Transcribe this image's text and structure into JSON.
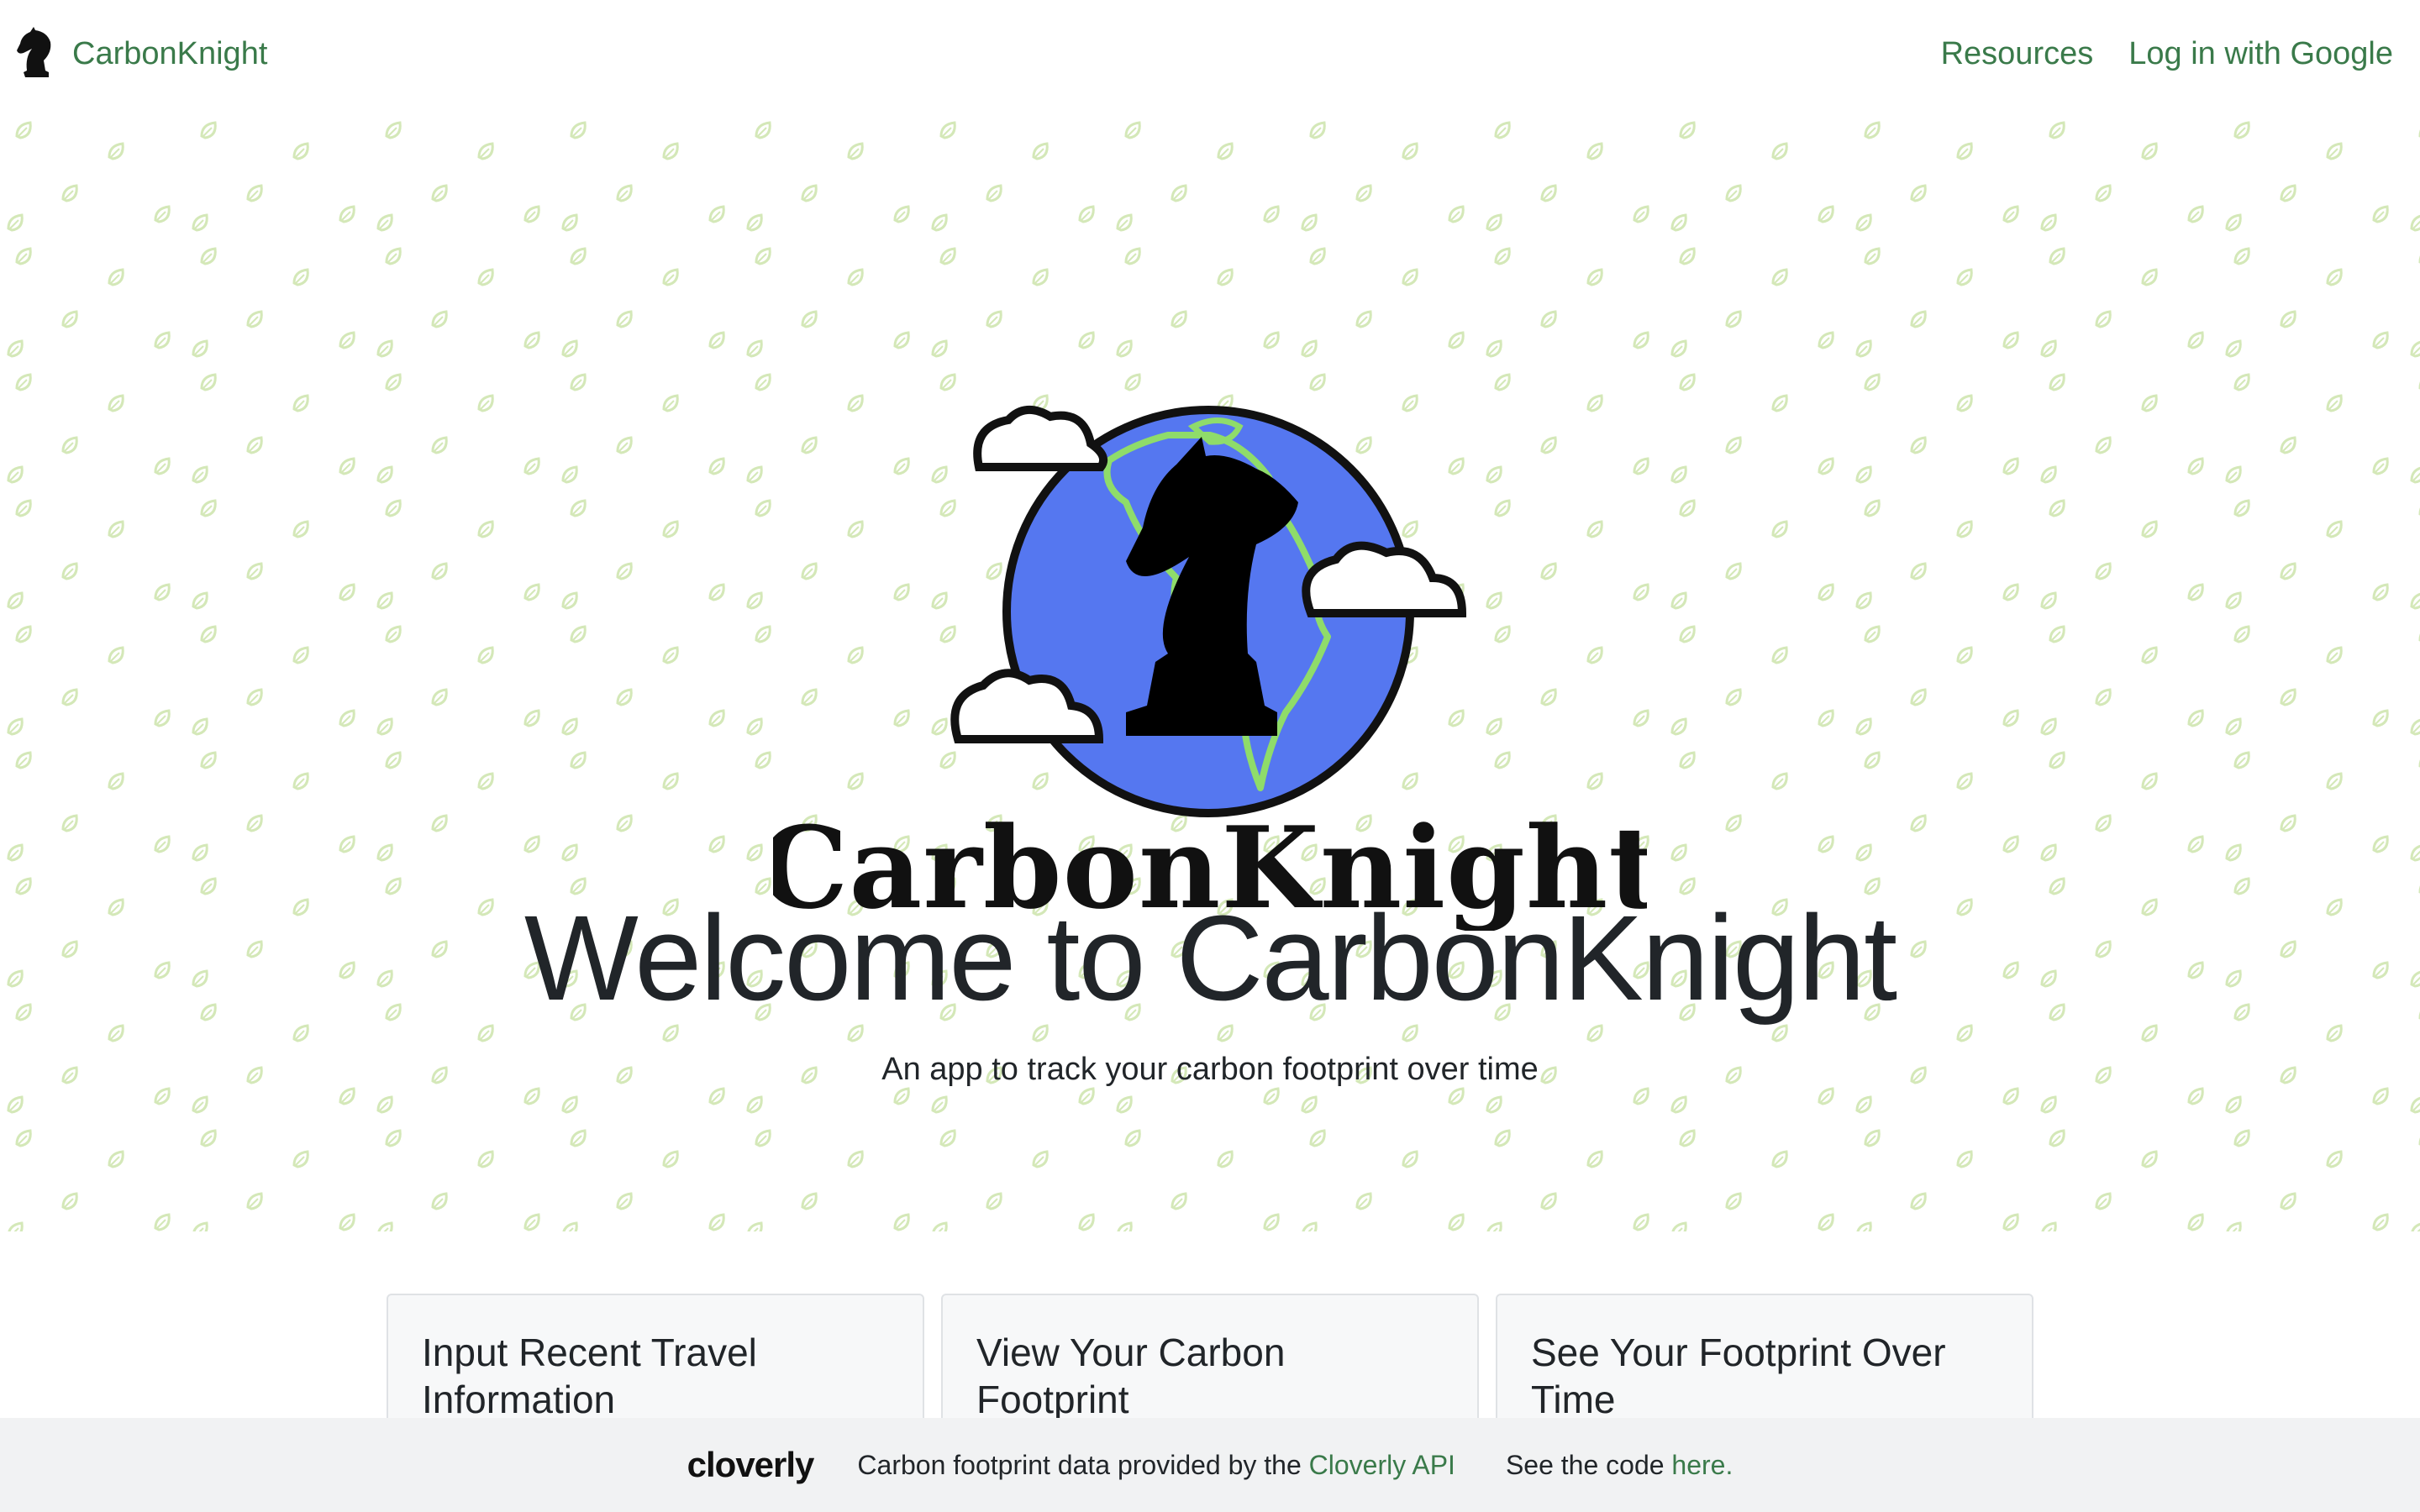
{
  "navbar": {
    "brand_name": "CarbonKnight",
    "brand_icon": "chess-knight-icon",
    "links": [
      {
        "label": "Resources"
      },
      {
        "label": "Log in with Google"
      }
    ]
  },
  "hero": {
    "logo_text": "CarbonKnight",
    "logo_icon": "globe-knight-logo",
    "title": "Welcome to CarbonKnight",
    "subtitle": "An app to track your carbon footprint over time",
    "pattern_icon": "leaf-icon"
  },
  "cards": [
    {
      "title": "Input Recent Travel Information"
    },
    {
      "title": "View Your Carbon Footprint"
    },
    {
      "title": "See Your Footprint Over Time"
    }
  ],
  "footer": {
    "partner_logo_text": "cloverly",
    "credit_prefix": "Carbon footprint data provided by the ",
    "credit_link": "Cloverly API",
    "code_prefix": "See the code ",
    "code_link": "here."
  },
  "colors": {
    "link_green": "#3a7a4a",
    "globe_blue": "#5577f0",
    "continent_green": "#8fdc6a",
    "leaf_pattern": "#d4e8b8",
    "footer_bg": "#f1f2f3"
  }
}
